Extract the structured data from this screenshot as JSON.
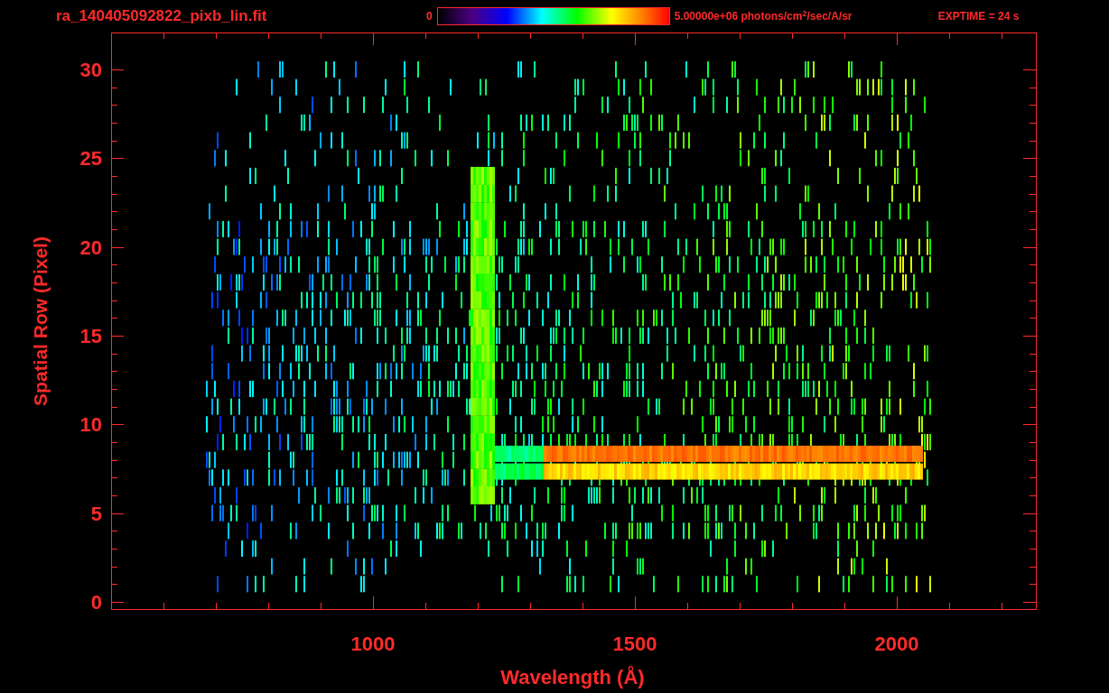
{
  "title": "ra_140405092822_pixb_lin.fit",
  "colorbar": {
    "min_label": "0",
    "max_label": "5.00000e+06 photons/cm$^{2}$/sec/A/sr"
  },
  "exposure": "EXPTIME = 24 s",
  "plot": {
    "xlabel": "Wavelength (Å)",
    "ylabel": "Spatial Row (Pixel)",
    "ytick_labels": [
      "30",
      "25",
      "20",
      "15",
      "10",
      "5",
      "0"
    ],
    "xtick_labels": [
      "1000",
      "1500",
      "2000"
    ]
  }
}
